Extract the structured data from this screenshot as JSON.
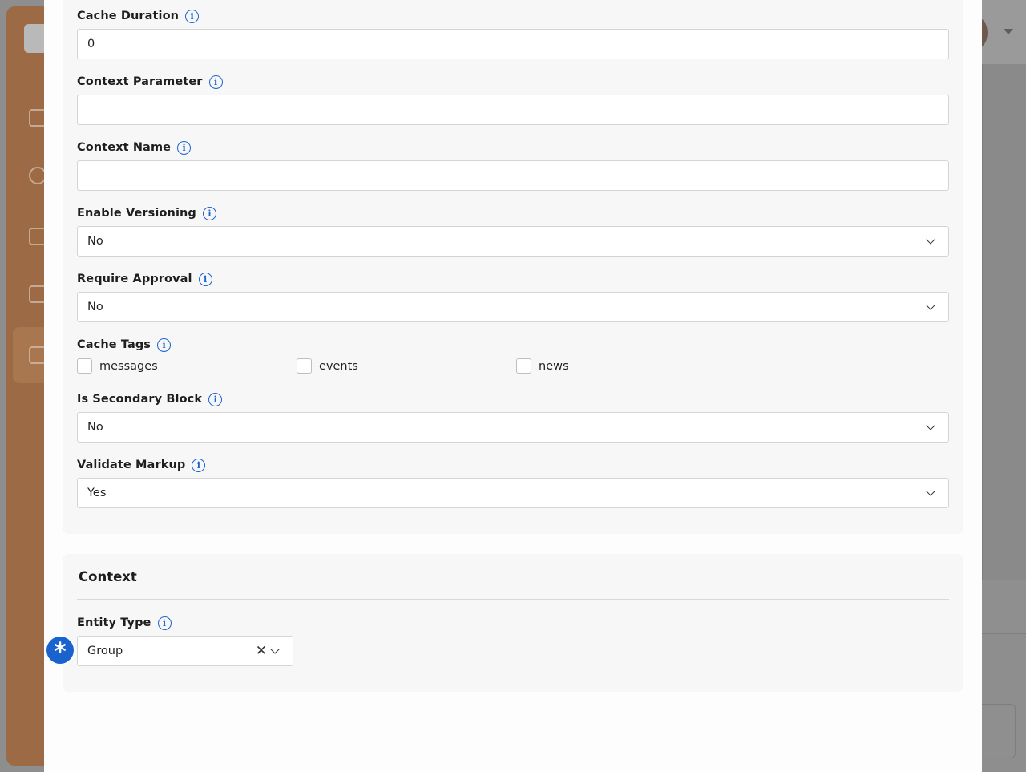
{
  "fields": {
    "cache_duration": {
      "label": "Cache Duration",
      "value": "0"
    },
    "context_parameter": {
      "label": "Context Parameter",
      "value": ""
    },
    "context_name": {
      "label": "Context Name",
      "value": ""
    },
    "enable_versioning": {
      "label": "Enable Versioning",
      "value": "No"
    },
    "require_approval": {
      "label": "Require Approval",
      "value": "No"
    },
    "cache_tags": {
      "label": "Cache Tags",
      "options": [
        "messages",
        "events",
        "news"
      ]
    },
    "is_secondary_block": {
      "label": "Is Secondary Block",
      "value": "No"
    },
    "validate_markup": {
      "label": "Validate Markup",
      "value": "Yes"
    }
  },
  "context": {
    "title": "Context",
    "entity_type": {
      "label": "Entity Type",
      "value": "Group"
    }
  },
  "icons": {
    "info": "info-icon",
    "chevron": "chevron-down-icon",
    "clear": "clear-icon",
    "required": "required-asterisk-icon"
  },
  "colors": {
    "accent": "#1c64d1",
    "required_badge": "#1a63cf",
    "sidebar": "#c87c47"
  }
}
